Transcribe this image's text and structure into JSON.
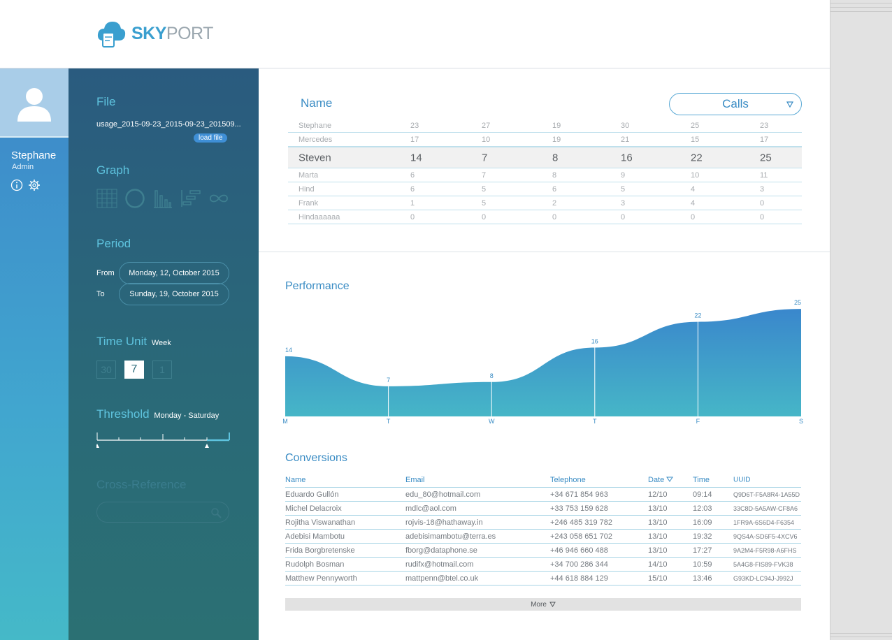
{
  "app": {
    "logo_primary": "SKY",
    "logo_secondary": "PORT",
    "brand_color": "#3a9fcf"
  },
  "user": {
    "name": "Stephane",
    "role": "Admin",
    "icons": [
      "info-icon",
      "gear-icon"
    ]
  },
  "panel": {
    "file": {
      "title": "File",
      "filename": "usage_2015-09-23_2015-09-23_201509...",
      "load_label": "load file"
    },
    "graph": {
      "title": "Graph",
      "types": [
        "table-icon",
        "pie-icon",
        "bar-icon",
        "gantt-icon",
        "infinity-icon"
      ]
    },
    "period": {
      "title": "Period",
      "from_label": "From",
      "from_value": "Monday, 12, October 2015",
      "to_label": "To",
      "to_value": "Sunday, 19, October 2015"
    },
    "time_unit": {
      "title": "Time Unit",
      "selected": "Week",
      "options": [
        "30",
        "7",
        "1"
      ],
      "active_index": 1
    },
    "threshold": {
      "title": "Threshold",
      "value": "Monday - Saturday"
    },
    "cross_reference": {
      "title": "Cross-Reference",
      "placeholder": ""
    }
  },
  "name_table": {
    "title": "Name",
    "metric": "Calls",
    "rows": [
      {
        "name": "Stephane",
        "values": [
          "23",
          "27",
          "19",
          "30",
          "25",
          "23"
        ]
      },
      {
        "name": "Mercedes",
        "values": [
          "17",
          "10",
          "19",
          "21",
          "15",
          "17"
        ]
      },
      {
        "name": "Steven",
        "values": [
          "14",
          "7",
          "8",
          "16",
          "22",
          "25"
        ],
        "highlight": true
      },
      {
        "name": "Marta",
        "values": [
          "6",
          "7",
          "8",
          "9",
          "10",
          "11"
        ]
      },
      {
        "name": "Hind",
        "values": [
          "6",
          "5",
          "6",
          "5",
          "4",
          "3"
        ]
      },
      {
        "name": "Frank",
        "values": [
          "1",
          "5",
          "2",
          "3",
          "4",
          "0"
        ]
      },
      {
        "name": "Hindaaaaaa",
        "values": [
          "0",
          "0",
          "0",
          "0",
          "0",
          "0"
        ]
      }
    ]
  },
  "performance": {
    "title": "Performance"
  },
  "chart_data": {
    "type": "area",
    "title": "Performance",
    "categories": [
      "M",
      "T",
      "W",
      "T",
      "F",
      "S"
    ],
    "values": [
      14,
      7,
      8,
      16,
      22,
      25
    ],
    "ylim": [
      0,
      26
    ],
    "grid": false,
    "colors": {
      "top": "#3a87cc",
      "bottom": "#46b6c7"
    }
  },
  "conversions": {
    "title": "Conversions",
    "columns": [
      "Name",
      "Email",
      "Telephone",
      "Date",
      "Time",
      "UUID"
    ],
    "sort_column": "Date",
    "rows": [
      [
        "Eduardo Gullón",
        "edu_80@hotmail.com",
        "+34 671 854 963",
        "12/10",
        "09:14",
        "Q9D6T-F5A8R4-1A55D"
      ],
      [
        "Michel Delacroix",
        "mdlc@aol.com",
        "+33 753 159 628",
        "13/10",
        "12:03",
        "33C8D-5A5AW-CF8A6"
      ],
      [
        "Rojitha Viswanathan",
        "rojvis-18@hathaway.in",
        "+246 485 319 782",
        "13/10",
        "16:09",
        "1FR9A-6S6D4-F6354"
      ],
      [
        "Adebisi Mambotu",
        "adebisimambotu@terra.es",
        "+243 058 651 702",
        "13/10",
        "19:32",
        "9QS4A-SD6F5-4XCV6"
      ],
      [
        "Frida Borgbretenske",
        "fborg@dataphone.se",
        "+46 946 660 488",
        "13/10",
        "17:27",
        "9A2M4-F5R98-A6FHS"
      ],
      [
        "Rudolph Bosman",
        "rudifx@hotmail.com",
        "+34 700 286 344",
        "14/10",
        "10:59",
        "5A4G8-FIS89-FVK38"
      ],
      [
        "Matthew Pennyworth",
        "mattpenn@btel.co.uk",
        "+44 618 884 129",
        "15/10",
        "13:46",
        "G93KD-LC94J-J992J"
      ]
    ],
    "more_label": "More"
  }
}
